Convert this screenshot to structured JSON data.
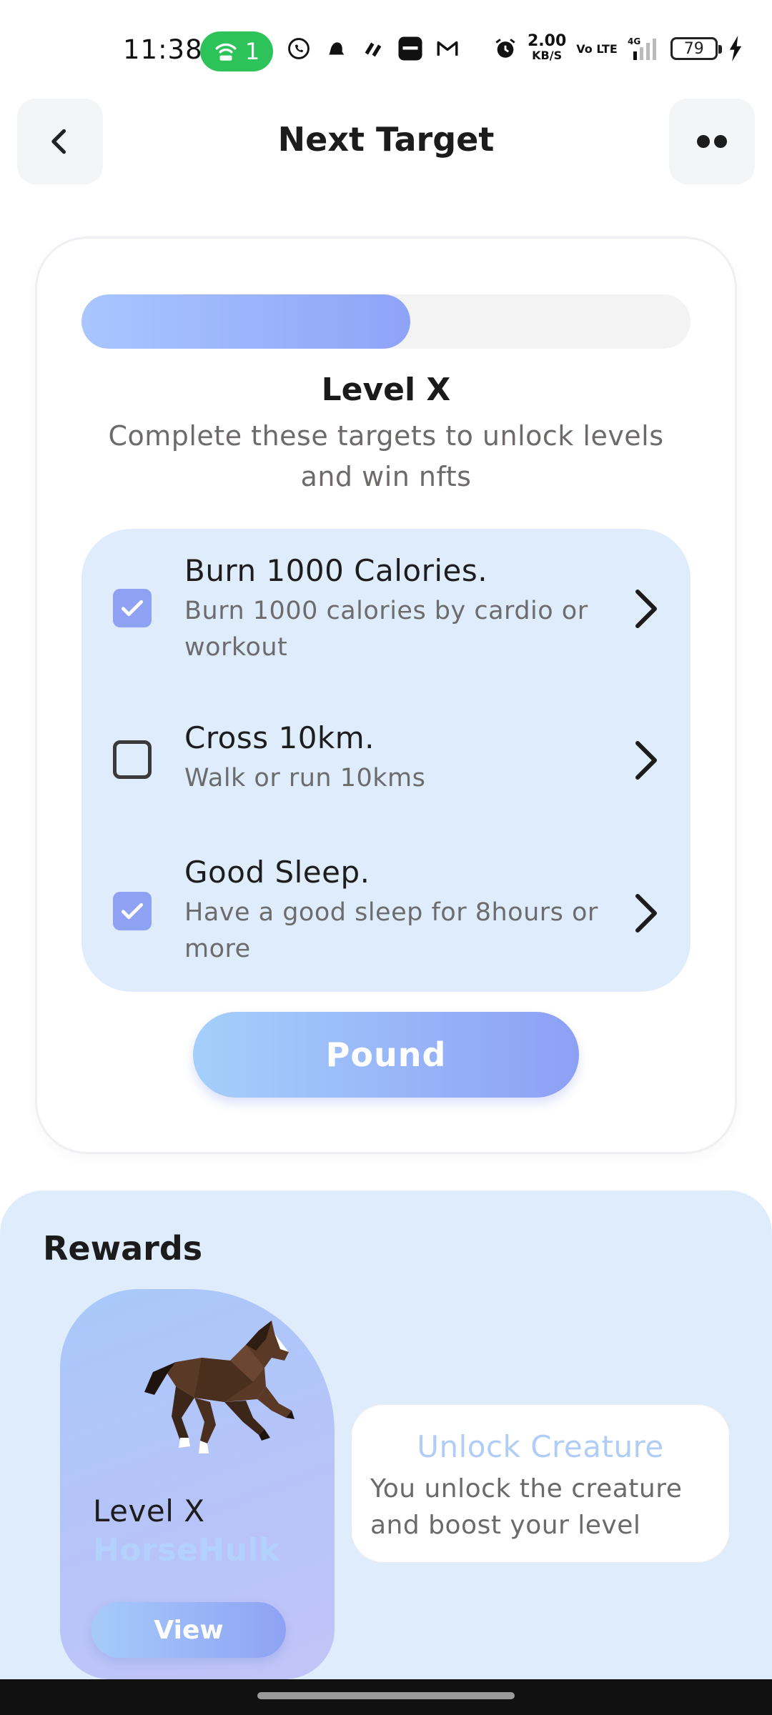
{
  "status_bar": {
    "time": "11:38",
    "hotspot_count": "1",
    "net_speed": "2.00",
    "net_unit": "KB/S",
    "volte": "Vo LTE",
    "network": "4G",
    "battery": "79",
    "icons": [
      "whatsapp-icon",
      "bell-app-icon",
      "chat-app-icon",
      "paytm-icon",
      "gmail-icon",
      "alarm-icon",
      "signal-icon",
      "charging-icon"
    ]
  },
  "header": {
    "title": "Next Target",
    "back_icon": "chevron-left-icon",
    "more_icon": "more-dots-icon"
  },
  "level": {
    "progress_fraction": 0.54,
    "title": "Level X",
    "description": "Complete these targets to unlock levels and win nfts"
  },
  "targets": [
    {
      "title": "Burn 1000 Calories.",
      "description": "Burn 1000 calories by cardio or workout",
      "checked": true
    },
    {
      "title": "Cross 10km.",
      "description": "Walk or run 10kms",
      "checked": false
    },
    {
      "title": "Good Sleep.",
      "description": "Have a good sleep for 8hours or more",
      "checked": true
    }
  ],
  "pound_button": "Pound",
  "rewards": {
    "title": "Rewards",
    "creature": {
      "level": "Level X",
      "name": "HorseHulk",
      "view_button": "View",
      "image": "horse-image"
    },
    "unlock": {
      "title": "Unlock Creature",
      "description": "You unlock the creature and boost your level"
    }
  },
  "colors": {
    "accent_blue": "#8ea3f7",
    "light_panel": "#deecfb",
    "check_on": "#8fa1f3"
  }
}
